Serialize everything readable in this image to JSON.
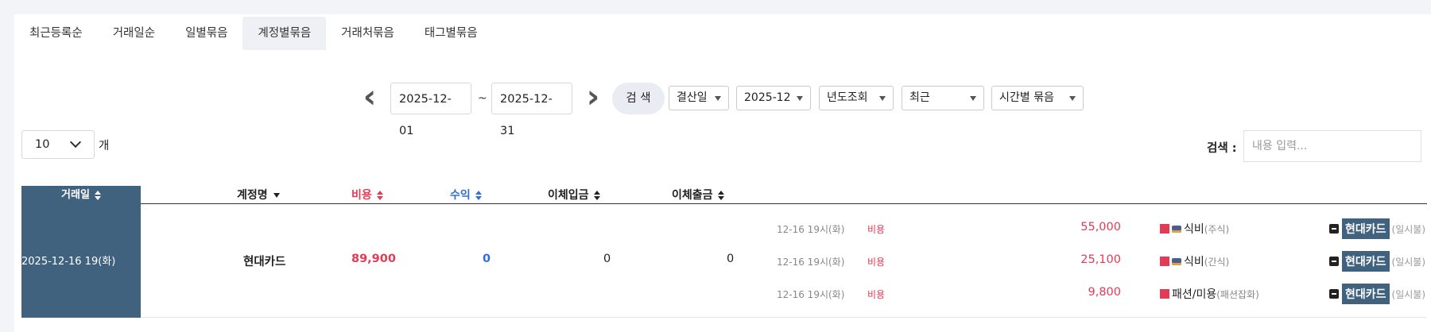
{
  "tabs": [
    "최근등록순",
    "거래일순",
    "일별묶음",
    "계정별묶음",
    "거래처묶음",
    "태그별묶음"
  ],
  "active_tab": "계정별묶음",
  "filters": {
    "date_from": "2025-12-01",
    "tilde": "~",
    "date_to": "2025-12-31",
    "search_button": "검 색",
    "date_type": "결산일",
    "month": "2025-12",
    "year_lookup": "년도조회",
    "recent": "최근",
    "grouping": "시간별 묶음"
  },
  "page_size": {
    "value": "10",
    "unit": "개"
  },
  "search": {
    "label": "검색 :",
    "placeholder": "내용 입력..."
  },
  "columns": {
    "date": "거래일",
    "account": "계정명",
    "expense": "비용",
    "income": "수익",
    "transfer_in": "이체입금",
    "transfer_out": "이체출금"
  },
  "group": {
    "date": "2025-12-16 19(화)",
    "account": "현대카드",
    "expense": "89,900",
    "income": "0",
    "transfer_in": "0",
    "transfer_out": "0"
  },
  "details": [
    {
      "time": "12-16 19시(화)",
      "kind": "비용",
      "amount": "55,000",
      "category": "식비",
      "subcategory": "(주식)",
      "category_icon": "book-icon",
      "account": "현대카드",
      "payment": "(일시불)"
    },
    {
      "time": "12-16 19시(화)",
      "kind": "비용",
      "amount": "25,100",
      "category": "식비",
      "subcategory": "(간식)",
      "category_icon": "book-icon",
      "account": "현대카드",
      "payment": "(일시불)"
    },
    {
      "time": "12-16 19시(화)",
      "kind": "비용",
      "amount": "9,800",
      "category": "패션/미용",
      "subcategory": "(패션잡화)",
      "category_icon": "",
      "account": "현대카드",
      "payment": "(일시불)"
    }
  ],
  "colors": {
    "header_bg": "#41627e",
    "expense": "#e23b55",
    "income": "#2f6fd6",
    "page_bg": "#f3f4f7"
  }
}
